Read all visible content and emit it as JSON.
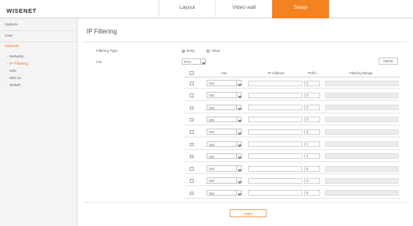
{
  "app": {
    "logo": "WISENET"
  },
  "nav": {
    "tabs": [
      {
        "label": "Layout",
        "active": false
      },
      {
        "label": "Video wall",
        "active": false
      },
      {
        "label": "Setup",
        "active": true
      }
    ]
  },
  "sidebar": {
    "items": [
      {
        "label": "System"
      },
      {
        "label": "User"
      },
      {
        "label": "Network",
        "active": true
      },
      {
        "label": "- Network"
      },
      {
        "label": "- IP Filtering",
        "active": true
      },
      {
        "label": "- SSL"
      },
      {
        "label": "- 802.1x"
      },
      {
        "label": "- SNMP"
      }
    ]
  },
  "page": {
    "title": "IP Filtering"
  },
  "form": {
    "filtering_type_label": "Filtering Type",
    "deny_label": "Deny",
    "allow_label": "Allow",
    "list_label": "List",
    "ip_version": "IPv4",
    "delete_label": "Delete",
    "apply_label": "Apply"
  },
  "table": {
    "headers": {
      "use": "Use",
      "ip": "IP Address",
      "prefix": "Prefix",
      "range": "Filtering Range"
    },
    "rows": [
      {
        "use": "ON",
        "ip": "",
        "prefix": "0",
        "range": ""
      },
      {
        "use": "ON",
        "ip": "",
        "prefix": "0",
        "range": ""
      },
      {
        "use": "ON",
        "ip": "",
        "prefix": "0",
        "range": ""
      },
      {
        "use": "ON",
        "ip": "",
        "prefix": "0",
        "range": ""
      },
      {
        "use": "ON",
        "ip": "",
        "prefix": "0",
        "range": ""
      },
      {
        "use": "ON",
        "ip": "",
        "prefix": "0",
        "range": ""
      },
      {
        "use": "ON",
        "ip": "",
        "prefix": "0",
        "range": ""
      },
      {
        "use": "ON",
        "ip": "",
        "prefix": "0",
        "range": ""
      },
      {
        "use": "ON",
        "ip": "",
        "prefix": "0",
        "range": ""
      },
      {
        "use": "ON",
        "ip": "",
        "prefix": "0",
        "range": ""
      }
    ]
  },
  "colors": {
    "accent": "#f58220"
  }
}
